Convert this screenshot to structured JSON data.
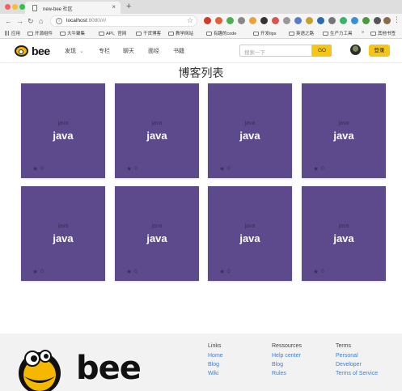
{
  "browser": {
    "tab_title": "new-bee 社区",
    "tab_close": "×",
    "new_tab": "+",
    "url_host": "localhost",
    "url_path": ":8080/#/",
    "bookmarks": [
      {
        "label": "应用",
        "icon": "apps-icon"
      },
      {
        "label": "开源组件",
        "icon": "folder-icon"
      },
      {
        "label": "大牛聚集",
        "icon": "folder-icon"
      },
      {
        "label": "API、官网",
        "icon": "folder-icon"
      },
      {
        "label": "干货博客",
        "icon": "folder-icon"
      },
      {
        "label": "教学网站",
        "icon": "folder-icon"
      },
      {
        "label": "有趣的code",
        "icon": "folder-icon"
      },
      {
        "label": "开发tips",
        "icon": "folder-icon"
      },
      {
        "label": "英语之路",
        "icon": "folder-icon"
      },
      {
        "label": "生产力工具",
        "icon": "folder-icon"
      },
      {
        "label": "»",
        "icon": ""
      },
      {
        "label": "其他书签",
        "icon": "folder-icon"
      }
    ]
  },
  "header": {
    "logo_text": "bee",
    "nav": [
      {
        "label": "发现",
        "caret": "⌄"
      },
      {
        "label": "专栏",
        "caret": ""
      },
      {
        "label": "聊天",
        "caret": ""
      },
      {
        "label": "面经",
        "caret": ""
      },
      {
        "label": "书籍",
        "caret": ""
      }
    ],
    "search_placeholder": "搜索一下",
    "search_button": "GO",
    "login_button": "登录"
  },
  "main": {
    "title": "博客列表",
    "cards": [
      {
        "tag": "java",
        "title": "java",
        "likes": "0"
      },
      {
        "tag": "java",
        "title": "java",
        "likes": "0"
      },
      {
        "tag": "java",
        "title": "java",
        "likes": "0"
      },
      {
        "tag": "java",
        "title": "java",
        "likes": "0"
      },
      {
        "tag": "java",
        "title": "java",
        "likes": "0"
      },
      {
        "tag": "java",
        "title": "java",
        "likes": "0"
      },
      {
        "tag": "java",
        "title": "java",
        "likes": "0"
      },
      {
        "tag": "java",
        "title": "java",
        "likes": "0"
      }
    ]
  },
  "footer": {
    "logo_text": "bee",
    "columns": [
      {
        "heading": "Links",
        "links": [
          "Home",
          "Blog",
          "Wiki"
        ]
      },
      {
        "heading": "Ressources",
        "links": [
          "Help center",
          "Blog",
          "Rules"
        ]
      },
      {
        "heading": "Terms",
        "links": [
          "Personal",
          "Developer",
          "Terms of Service"
        ]
      }
    ]
  },
  "colors": {
    "card_bg": "#5d4a8c",
    "accent_yellow": "#f5c518",
    "link_blue": "#3d7fd6"
  }
}
